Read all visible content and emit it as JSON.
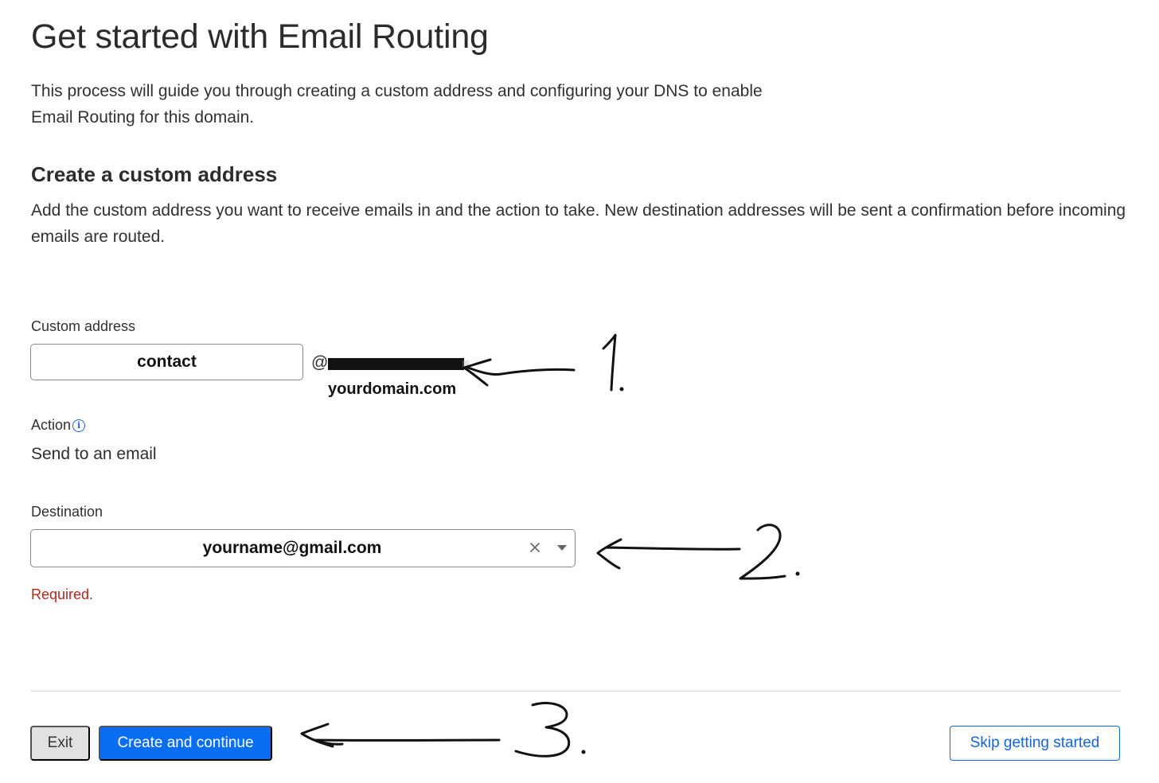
{
  "header": {
    "title": "Get started with Email Routing",
    "intro": "This process will guide you through creating a custom address and configuring your DNS to enable Email Routing for this domain."
  },
  "section": {
    "title": "Create a custom address",
    "description": "Add the custom address you want to receive emails in and the action to take. New destination addresses will be sent a confirmation before incoming emails are routed."
  },
  "custom_address": {
    "label": "Custom address",
    "value": "contact",
    "at": "@",
    "domain_annotation": "yourdomain.com"
  },
  "action": {
    "label": "Action",
    "info_icon": "ⓘ",
    "value": "Send to an email"
  },
  "destination": {
    "label": "Destination",
    "value": "yourname@gmail.com",
    "error": "Required."
  },
  "footer": {
    "exit_label": "Exit",
    "create_label": "Create and continue",
    "skip_label": "Skip getting started"
  },
  "colors": {
    "primary": "#0a6ef2",
    "link": "#1565d8",
    "error": "#b3261e",
    "exit_bg": "#e1e1e1"
  },
  "icons": {
    "info": "info-icon",
    "clear": "close-icon",
    "dropdown": "chevron-down-icon"
  }
}
